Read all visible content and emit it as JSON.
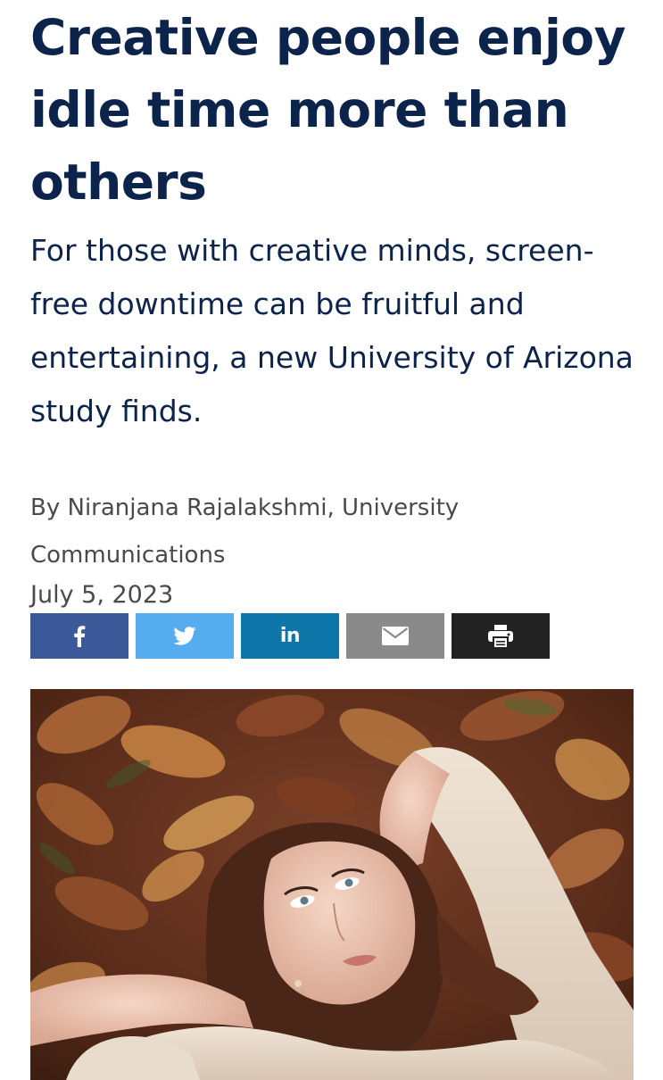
{
  "article": {
    "headline": "Creative people enjoy idle time more than others",
    "subheadline": "For those with creative minds, screen-free downtime can be fruitful and entertaining, a new University of Arizona study finds.",
    "byline": "By Niranjana Rajalakshmi, University Communications",
    "date": "July 5, 2023"
  },
  "share": {
    "buttons": [
      {
        "icon": "facebook-icon",
        "color": "#3b5998"
      },
      {
        "icon": "twitter-icon",
        "color": "#55acee"
      },
      {
        "icon": "linkedin-icon",
        "label": "in",
        "color": "#0e76a8"
      },
      {
        "icon": "email-icon",
        "color": "#8a8a8a"
      },
      {
        "icon": "print-icon",
        "color": "#222222"
      }
    ]
  },
  "colors": {
    "headline": "#0c234b",
    "meta_text": "#4a4a4a"
  }
}
